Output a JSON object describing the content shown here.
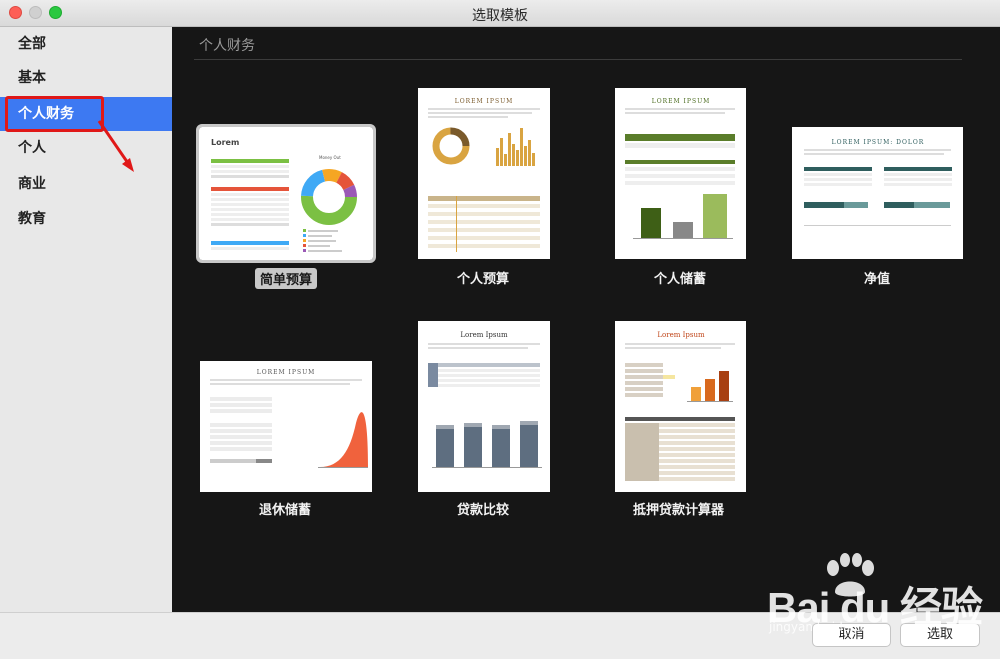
{
  "window": {
    "title": "选取模板"
  },
  "sidebar": {
    "items": [
      {
        "label": "全部"
      },
      {
        "label": "基本"
      },
      {
        "label": "个人财务"
      },
      {
        "label": "个人"
      },
      {
        "label": "商业"
      },
      {
        "label": "教育"
      }
    ],
    "selected": "个人财务"
  },
  "main": {
    "section_title": "个人财务",
    "templates": [
      {
        "name": "简单预算",
        "selected": true,
        "thumb_heading": "Lorem"
      },
      {
        "name": "个人预算",
        "selected": false,
        "thumb_heading": "LOREM IPSUM"
      },
      {
        "name": "个人储蓄",
        "selected": false,
        "thumb_heading": "LOREM IPSUM"
      },
      {
        "name": "净值",
        "selected": false,
        "thumb_heading": "LOREM IPSUM: DOLOR"
      },
      {
        "name": "退休储蓄",
        "selected": false,
        "thumb_heading": "LOREM IPSUM"
      },
      {
        "name": "贷款比较",
        "selected": false,
        "thumb_heading": "Lorem Ipsum"
      },
      {
        "name": "抵押贷款计算器",
        "selected": false,
        "thumb_heading": "Lorem Ipsum"
      }
    ]
  },
  "footer": {
    "cancel_label": "取消",
    "choose_label": "选取"
  },
  "watermark": {
    "brand": "Bai du 经验",
    "url": "jingyan.baidu.com"
  },
  "colors": {
    "accent": "#3d79f2",
    "highlight": "#e01818",
    "main_bg": "#161616"
  }
}
